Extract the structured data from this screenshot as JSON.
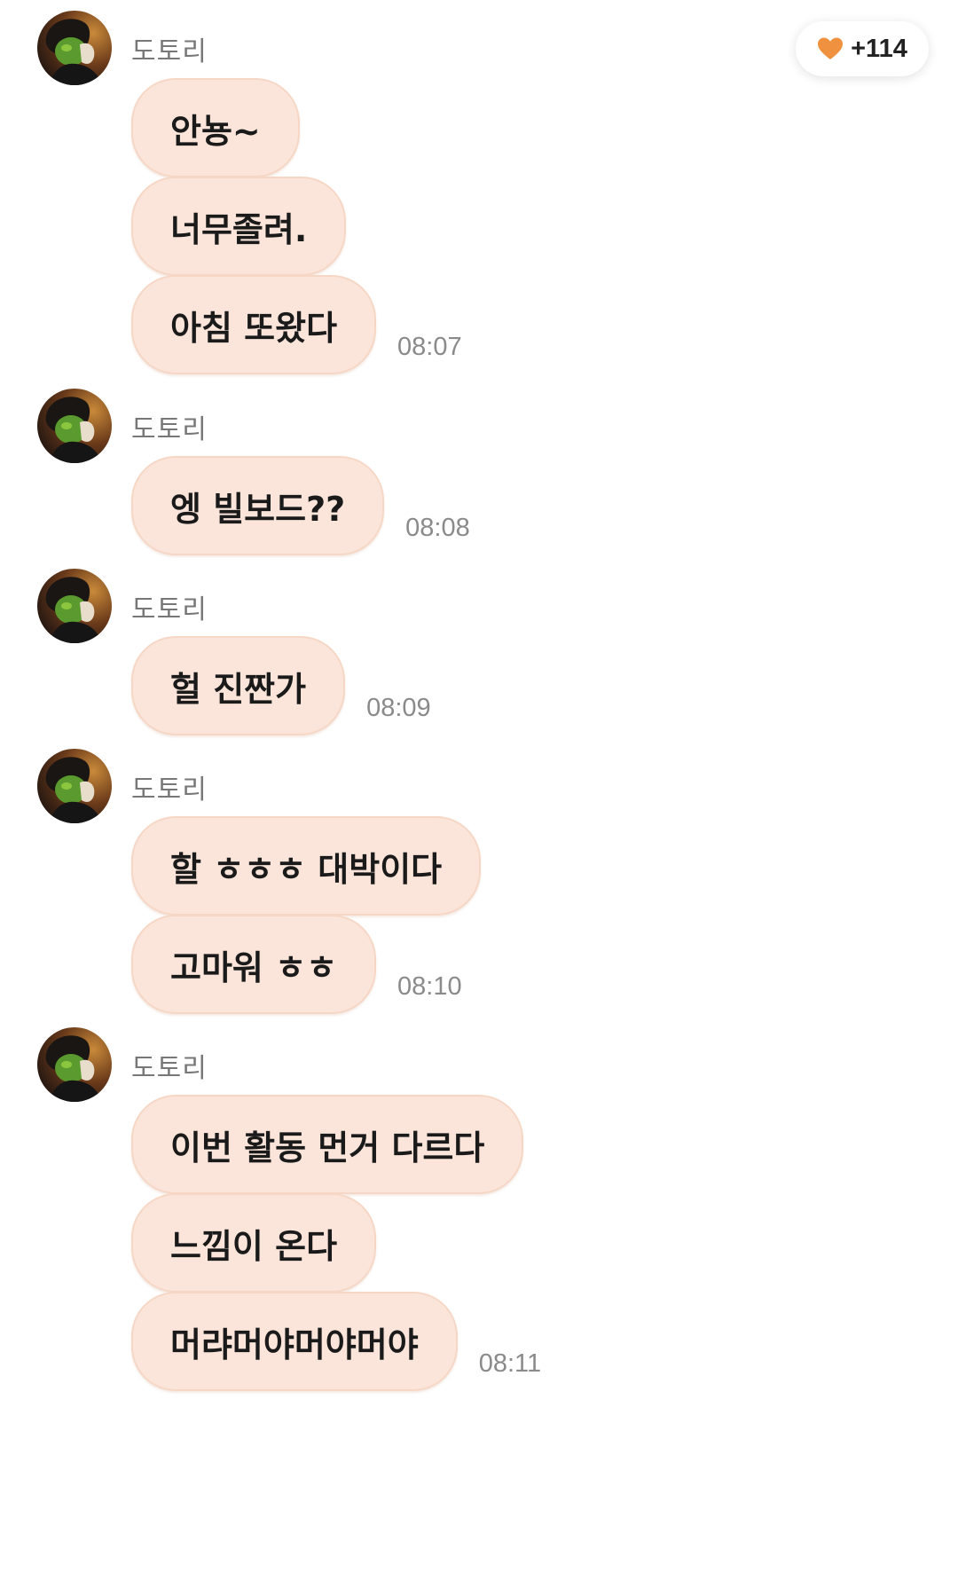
{
  "likes_badge": {
    "icon": "heart-icon",
    "count": "+114",
    "heart_color": "#f0913f"
  },
  "colors": {
    "bubble": "#fbe5da",
    "bubble_border": "#f6d7c6",
    "time": "#8a8a8a",
    "sender": "#777777"
  },
  "groups": [
    {
      "sender": "도토리",
      "messages": [
        "안뇽~",
        "너무졸려.",
        "아침 또왔다"
      ],
      "time": "08:07"
    },
    {
      "sender": "도토리",
      "messages": [
        "엥 빌보드??"
      ],
      "time": "08:08"
    },
    {
      "sender": "도토리",
      "messages": [
        "헐 진짠가"
      ],
      "time": "08:09"
    },
    {
      "sender": "도토리",
      "messages": [
        "할 ㅎㅎㅎ 대박이다",
        "고마워 ㅎㅎ"
      ],
      "time": "08:10"
    },
    {
      "sender": "도토리",
      "messages": [
        "이번 활동 먼거 다르다",
        "느낌이 온다",
        "머랴머야머야머야"
      ],
      "time": "08:11"
    }
  ]
}
